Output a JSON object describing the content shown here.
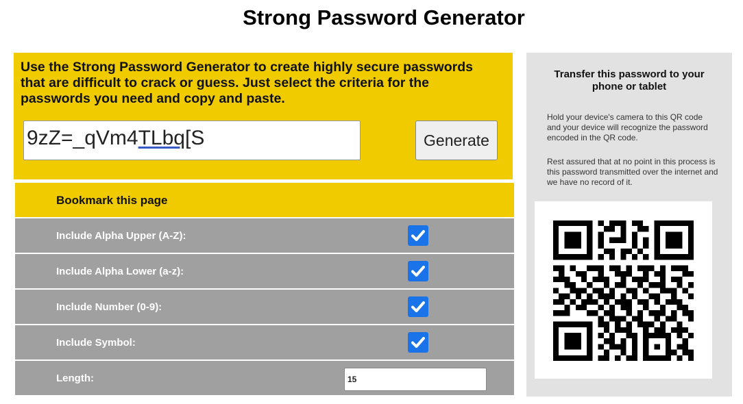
{
  "page": {
    "title": "Strong Password Generator"
  },
  "generator": {
    "intro": "Use the Strong Password Generator to create highly secure passwords that are difficult to crack or guess. Just select the criteria for the passwords you need and copy and paste.",
    "password_prefix": "9zZ=_qVm4",
    "password_underlined": "TLbq[",
    "password_suffix": "S",
    "generate_label": "Generate"
  },
  "bookmark": {
    "label": "Bookmark this page"
  },
  "options": [
    {
      "label": "Include Alpha Upper (A-Z):",
      "checked": true
    },
    {
      "label": "Include Alpha Lower (a-z):",
      "checked": true
    },
    {
      "label": "Include Number (0-9):",
      "checked": true
    },
    {
      "label": "Include Symbol:",
      "checked": true
    }
  ],
  "length": {
    "label": "Length:",
    "value": "15"
  },
  "transfer": {
    "title": "Transfer this password to your phone or tablet",
    "instructions": "Hold your device's camera to this QR code and your device will recognize the password encoded in the QR code.",
    "assurance": "Rest assured that at no point in this process is this password transmitted over the internet and we have no record of it."
  },
  "colors": {
    "accent_yellow": "#efcb00",
    "row_gray": "#a0a0a0",
    "checkbox_blue": "#1a73e8",
    "side_panel": "#e2e2e2"
  },
  "icons": {
    "checkbox": "checkmark-icon",
    "qr": "qr-code-icon"
  }
}
